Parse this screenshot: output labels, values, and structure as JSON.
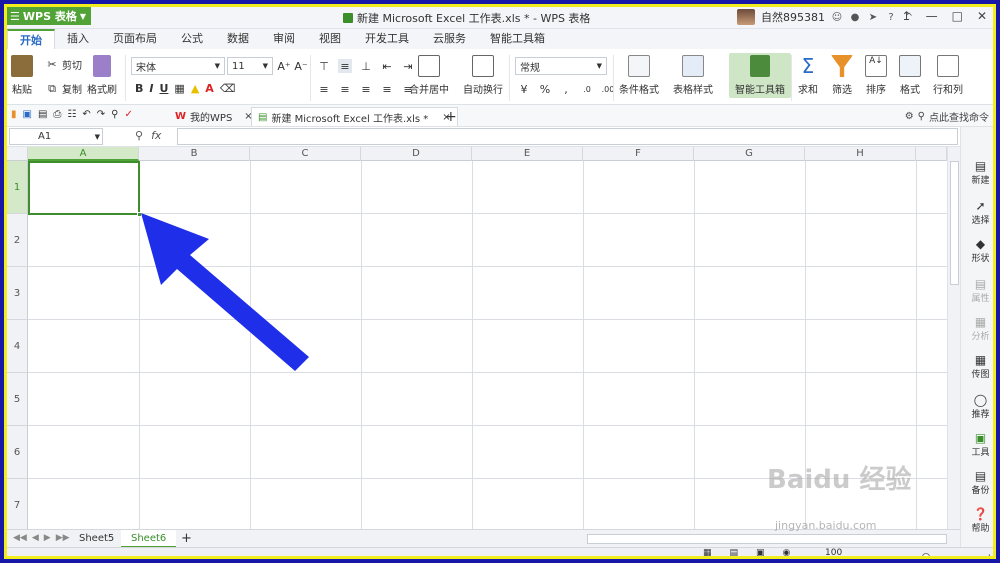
{
  "app": {
    "name": "WPS 表格"
  },
  "window": {
    "title": "新建 Microsoft Excel 工作表.xls * - WPS 表格",
    "user": "自然895381"
  },
  "ribbon_tabs": [
    "开始",
    "插入",
    "页面布局",
    "公式",
    "数据",
    "审阅",
    "视图",
    "开发工具",
    "云服务",
    "智能工具箱"
  ],
  "ribbon": {
    "paste": "粘贴",
    "cut": "剪切",
    "copy": "复制",
    "format_painter": "格式刷",
    "font_name": "宋体",
    "font_size": "11",
    "merge_center": "合并居中",
    "wrap_text": "自动换行",
    "number_format": "常规",
    "conditional_format": "条件格式",
    "table_style": "表格样式",
    "smart_toolbox": "智能工具箱",
    "sum": "求和",
    "filter": "筛选",
    "sort": "排序",
    "format": "格式",
    "rows_cols": "行和列"
  },
  "doc_tabs": {
    "home": "我的WPS",
    "file": "新建 Microsoft Excel 工作表.xls *",
    "search": "点此查找命令"
  },
  "formula_bar": {
    "name_box": "A1",
    "fx": "fx",
    "content": ""
  },
  "columns": [
    "A",
    "B",
    "C",
    "D",
    "E",
    "F",
    "G",
    "H"
  ],
  "rows": [
    "1",
    "2",
    "3",
    "4",
    "5",
    "6",
    "7"
  ],
  "right_pane": [
    "新建",
    "选择",
    "形状",
    "属性",
    "分析",
    "传图",
    "推荐",
    "工具",
    "备份",
    "帮助"
  ],
  "sheets": [
    "Sheet5",
    "Sheet6"
  ],
  "active_sheet": "Sheet6",
  "status": {
    "zoom": "100 %"
  },
  "watermark": {
    "logo": "Baidu 经验",
    "url": "jingyan.baidu.com"
  },
  "colors": {
    "accent_green": "#52a337",
    "arrow_blue": "#1f2ee8",
    "frame_yellow": "#f2ee1e"
  }
}
